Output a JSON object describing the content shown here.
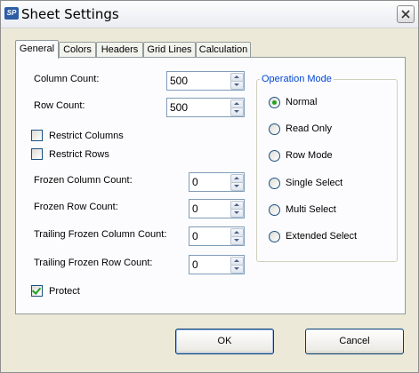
{
  "window": {
    "title": "Sheet Settings",
    "icon_text": "SP",
    "close_icon": "close-x"
  },
  "tabs": [
    {
      "label": "General",
      "active": true
    },
    {
      "label": "Colors",
      "active": false
    },
    {
      "label": "Headers",
      "active": false
    },
    {
      "label": "Grid Lines",
      "active": false
    },
    {
      "label": "Calculation",
      "active": false
    }
  ],
  "general": {
    "column_count": {
      "label": "Column Count:",
      "value": "500"
    },
    "row_count": {
      "label": "Row Count:",
      "value": "500"
    },
    "restrict_columns": {
      "label": "Restrict Columns",
      "checked": false
    },
    "restrict_rows": {
      "label": "Restrict Rows",
      "checked": false
    },
    "frozen_column_count": {
      "label": "Frozen Column Count:",
      "value": "0"
    },
    "frozen_row_count": {
      "label": "Frozen Row Count:",
      "value": "0"
    },
    "trailing_frozen_column_count": {
      "label": "Trailing Frozen Column Count:",
      "value": "0"
    },
    "trailing_frozen_row_count": {
      "label": "Trailing Frozen Row Count:",
      "value": "0"
    },
    "protect": {
      "label": "Protect",
      "checked": true
    }
  },
  "operation_mode": {
    "title": "Operation Mode",
    "options": [
      {
        "label": "Normal",
        "selected": true
      },
      {
        "label": "Read Only",
        "selected": false
      },
      {
        "label": "Row Mode",
        "selected": false
      },
      {
        "label": "Single Select",
        "selected": false
      },
      {
        "label": "Multi Select",
        "selected": false
      },
      {
        "label": "Extended Select",
        "selected": false
      }
    ]
  },
  "buttons": {
    "ok_label": "OK",
    "cancel_label": "Cancel"
  },
  "colors": {
    "group_title": "#0046d5",
    "check_accent": "#21a121",
    "button_border": "#003c74"
  }
}
